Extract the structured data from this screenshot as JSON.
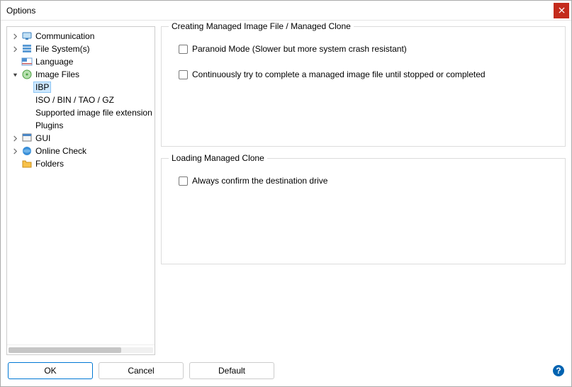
{
  "window": {
    "title": "Options"
  },
  "tree": {
    "items": [
      {
        "label": "Communication",
        "depth": 0,
        "expander": "closed",
        "icon": "comm"
      },
      {
        "label": "File System(s)",
        "depth": 0,
        "expander": "closed",
        "icon": "fs"
      },
      {
        "label": "Language",
        "depth": 0,
        "expander": "none",
        "icon": "lang"
      },
      {
        "label": "Image Files",
        "depth": 0,
        "expander": "open",
        "icon": "img"
      },
      {
        "label": "IBP",
        "depth": 1,
        "expander": "none",
        "icon": "none",
        "selected": true
      },
      {
        "label": "ISO / BIN / TAO / GZ",
        "depth": 1,
        "expander": "none",
        "icon": "none"
      },
      {
        "label": "Supported image file extension",
        "depth": 1,
        "expander": "none",
        "icon": "none"
      },
      {
        "label": "Plugins",
        "depth": 1,
        "expander": "none",
        "icon": "none"
      },
      {
        "label": "GUI",
        "depth": 0,
        "expander": "closed",
        "icon": "gui"
      },
      {
        "label": "Online Check",
        "depth": 0,
        "expander": "closed",
        "icon": "online"
      },
      {
        "label": "Folders",
        "depth": 0,
        "expander": "none",
        "icon": "folder"
      }
    ]
  },
  "groups": {
    "creating": {
      "title": "Creating Managed Image File / Managed Clone",
      "options": [
        {
          "label": "Paranoid Mode (Slower but more system crash resistant)",
          "checked": false
        },
        {
          "label": "Continuously try to complete a managed image file until stopped or completed",
          "checked": false
        }
      ]
    },
    "loading": {
      "title": "Loading Managed Clone",
      "options": [
        {
          "label": "Always confirm the destination drive",
          "checked": false
        }
      ]
    }
  },
  "buttons": {
    "ok": "OK",
    "cancel": "Cancel",
    "default": "Default"
  }
}
